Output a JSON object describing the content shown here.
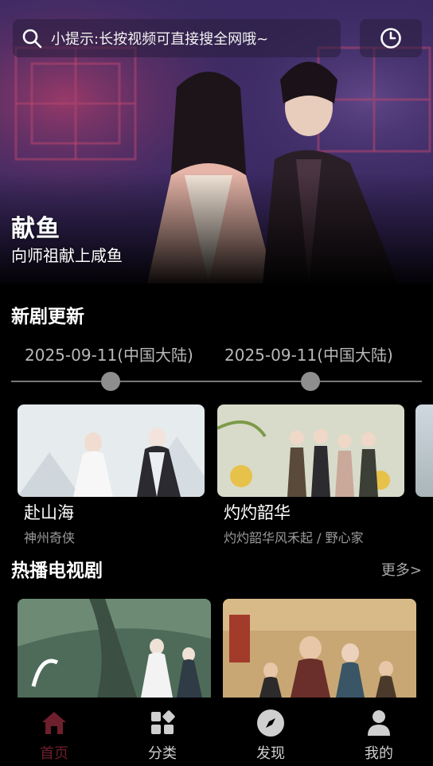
{
  "search": {
    "placeholder": "小提示:长按视频可直接搜全网哦~"
  },
  "hero": {
    "title": "献鱼",
    "subtitle": "向师祖献上咸鱼"
  },
  "new_dramas": {
    "title": "新剧更新",
    "timeline": [
      "2025-09-11(中国大陆)",
      "2025-09-11(中国大陆)"
    ],
    "items": [
      {
        "title": "赴山海",
        "subtitle": "神州奇侠"
      },
      {
        "title": "灼灼韶华",
        "subtitle": "灼灼韶华风禾起 / 野心家"
      }
    ]
  },
  "hot_tv": {
    "title": "热播电视剧",
    "more": "更多>"
  },
  "nav": {
    "items": [
      {
        "label": "首页",
        "icon": "home-icon"
      },
      {
        "label": "分类",
        "icon": "category-icon"
      },
      {
        "label": "发现",
        "icon": "compass-icon"
      },
      {
        "label": "我的",
        "icon": "user-icon"
      }
    ],
    "active_color": "#6e1f2c"
  }
}
